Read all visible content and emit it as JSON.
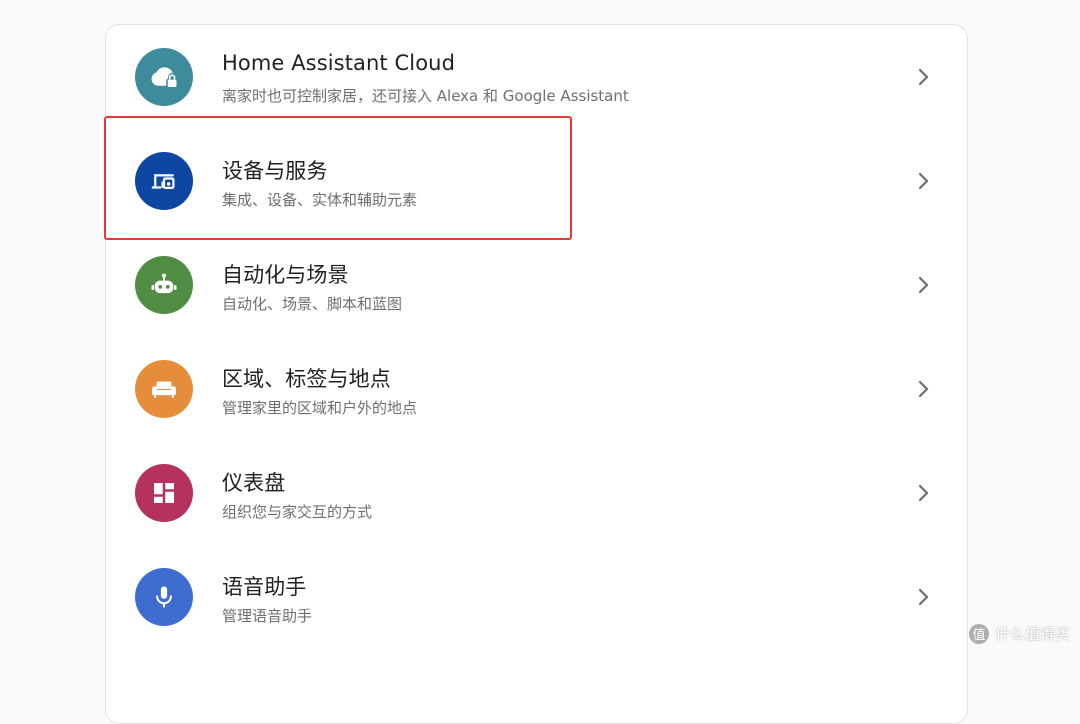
{
  "menu": {
    "items": [
      {
        "title": "Home Assistant Cloud",
        "subtitle": "离家时也可控制家居，还可接入 Alexa 和 Google Assistant",
        "icon": "cloud-lock-icon",
        "color": "#3e8c9b"
      },
      {
        "title": "设备与服务",
        "subtitle": "集成、设备、实体和辅助元素",
        "icon": "devices-icon",
        "color": "#0d47a1"
      },
      {
        "title": "自动化与场景",
        "subtitle": "自动化、场景、脚本和蓝图",
        "icon": "robot-icon",
        "color": "#518c43"
      },
      {
        "title": "区域、标签与地点",
        "subtitle": "管理家里的区域和户外的地点",
        "icon": "sofa-icon",
        "color": "#e68d3b"
      },
      {
        "title": "仪表盘",
        "subtitle": "组织您与家交互的方式",
        "icon": "dashboard-icon",
        "color": "#b5325f"
      },
      {
        "title": "语音助手",
        "subtitle": "管理语音助手",
        "icon": "microphone-icon",
        "color": "#3e6ccf"
      }
    ]
  },
  "highlight": {
    "color": "#e53935"
  },
  "watermark": {
    "badge": "值",
    "text": "什么值得买"
  }
}
